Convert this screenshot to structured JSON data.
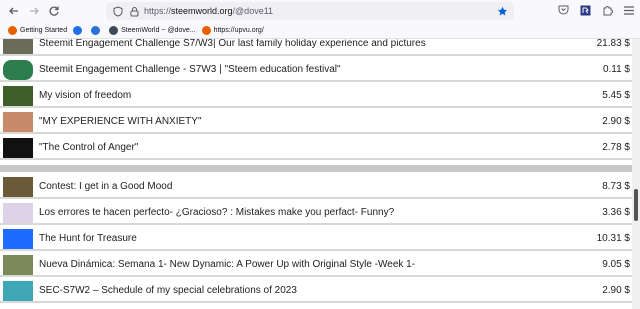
{
  "browser": {
    "url_prefix": "https://",
    "url_host": "steemworld.org",
    "url_path": "/@dove11",
    "bookmarks": [
      {
        "label": "Getting Started",
        "color": "#e66000"
      },
      {
        "label": "",
        "color": "#1f6fe5"
      },
      {
        "label": "",
        "color": "#2b6fd9"
      },
      {
        "label": "SteemWorld ~ @dove...",
        "color": "#3d4a5a"
      },
      {
        "label": "https://upvu.org/",
        "color": "#e66000"
      }
    ]
  },
  "posts": [
    {
      "title": "Steemit Engagement Challenge S7/W3| Our last family holiday experience and pictures",
      "amount": "21.83 $",
      "thumb": "#6b6b5a"
    },
    {
      "title": "Steemit Engagement Challenge - S7W3 | \"Steem education festival\"",
      "amount": "0.11 $",
      "thumb": "#2e7d4f"
    },
    {
      "title": "My vision of freedom",
      "amount": "5.45 $",
      "thumb": "#3f5f2a"
    },
    {
      "title": "\"MY EXPERIENCE WITH ANXIETY\"",
      "amount": "2.90 $",
      "thumb": "#c98a6a"
    },
    {
      "title": "\"The Control of Anger\"",
      "amount": "2.78 $",
      "thumb": "#111111"
    },
    {
      "title": "Contest: I get in a Good Mood",
      "amount": "8.73 $",
      "thumb": "#6a5a3a"
    },
    {
      "title": "Los errores te hacen perfecto- ¿Gracioso? : Mistakes make you perfact- Funny?",
      "amount": "3.36 $",
      "thumb": "#dcd4e6"
    },
    {
      "title": "The Hunt for Treasure",
      "amount": "10.31 $",
      "thumb": "#1e6bff"
    },
    {
      "title": "Nueva Dinámica: Semana 1- New Dynamic: A Power Up with Original Style -Week 1-",
      "amount": "9.05 $",
      "thumb": "#7a8a5a"
    },
    {
      "title": "SEC-S7W2 – Schedule of my special celebrations of 2023",
      "amount": "2.90 $",
      "thumb": "#3fa6b5"
    }
  ]
}
